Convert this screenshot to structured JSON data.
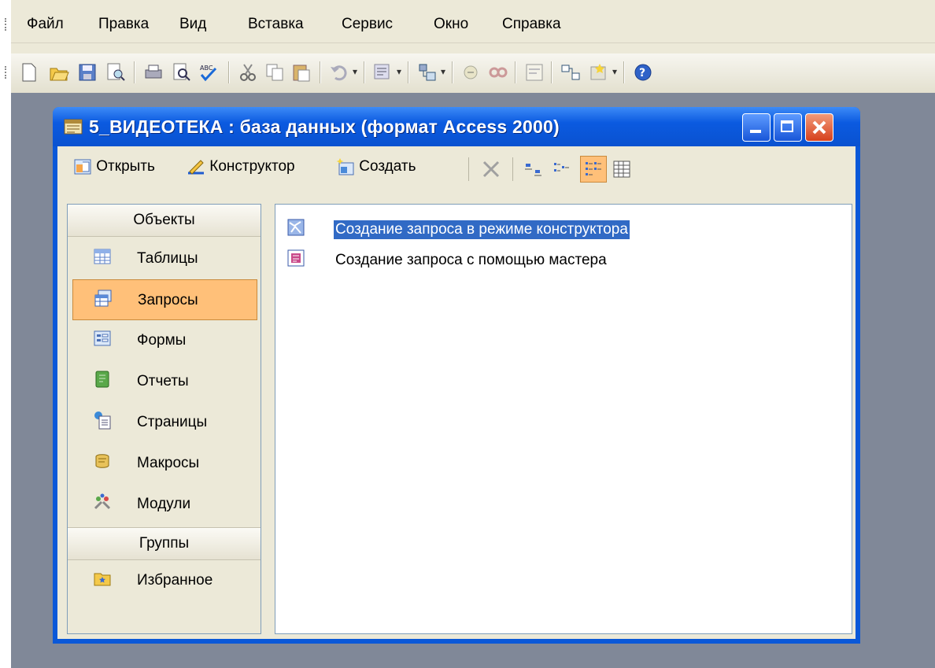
{
  "menu": [
    "Файл",
    "Правка",
    "Вид",
    "Вставка",
    "Сервис",
    "Окно",
    "Справка"
  ],
  "window": {
    "title": "5_ВИДЕОТЕКА : база данных (формат Access 2000)"
  },
  "db_toolbar": {
    "open": "Открыть",
    "design": "Конструктор",
    "create": "Создать"
  },
  "objects": {
    "header": "Объекты",
    "items": [
      {
        "label": "Таблицы",
        "icon": "table-icon"
      },
      {
        "label": "Запросы",
        "icon": "query-icon",
        "selected": true
      },
      {
        "label": "Формы",
        "icon": "form-icon"
      },
      {
        "label": "Отчеты",
        "icon": "report-icon"
      },
      {
        "label": "Страницы",
        "icon": "page-icon"
      },
      {
        "label": "Макросы",
        "icon": "macro-icon"
      },
      {
        "label": "Модули",
        "icon": "module-icon"
      }
    ],
    "groups_header": "Группы",
    "favorites": "Избранное"
  },
  "list": [
    {
      "label": "Создание запроса в режиме конструктора",
      "active": true
    },
    {
      "label": "Создание запроса с помощью мастера",
      "active": false
    }
  ],
  "colors": {
    "title_blue": "#0a58d8",
    "selection": "#316ac5",
    "selected_object": "#ffc079"
  }
}
